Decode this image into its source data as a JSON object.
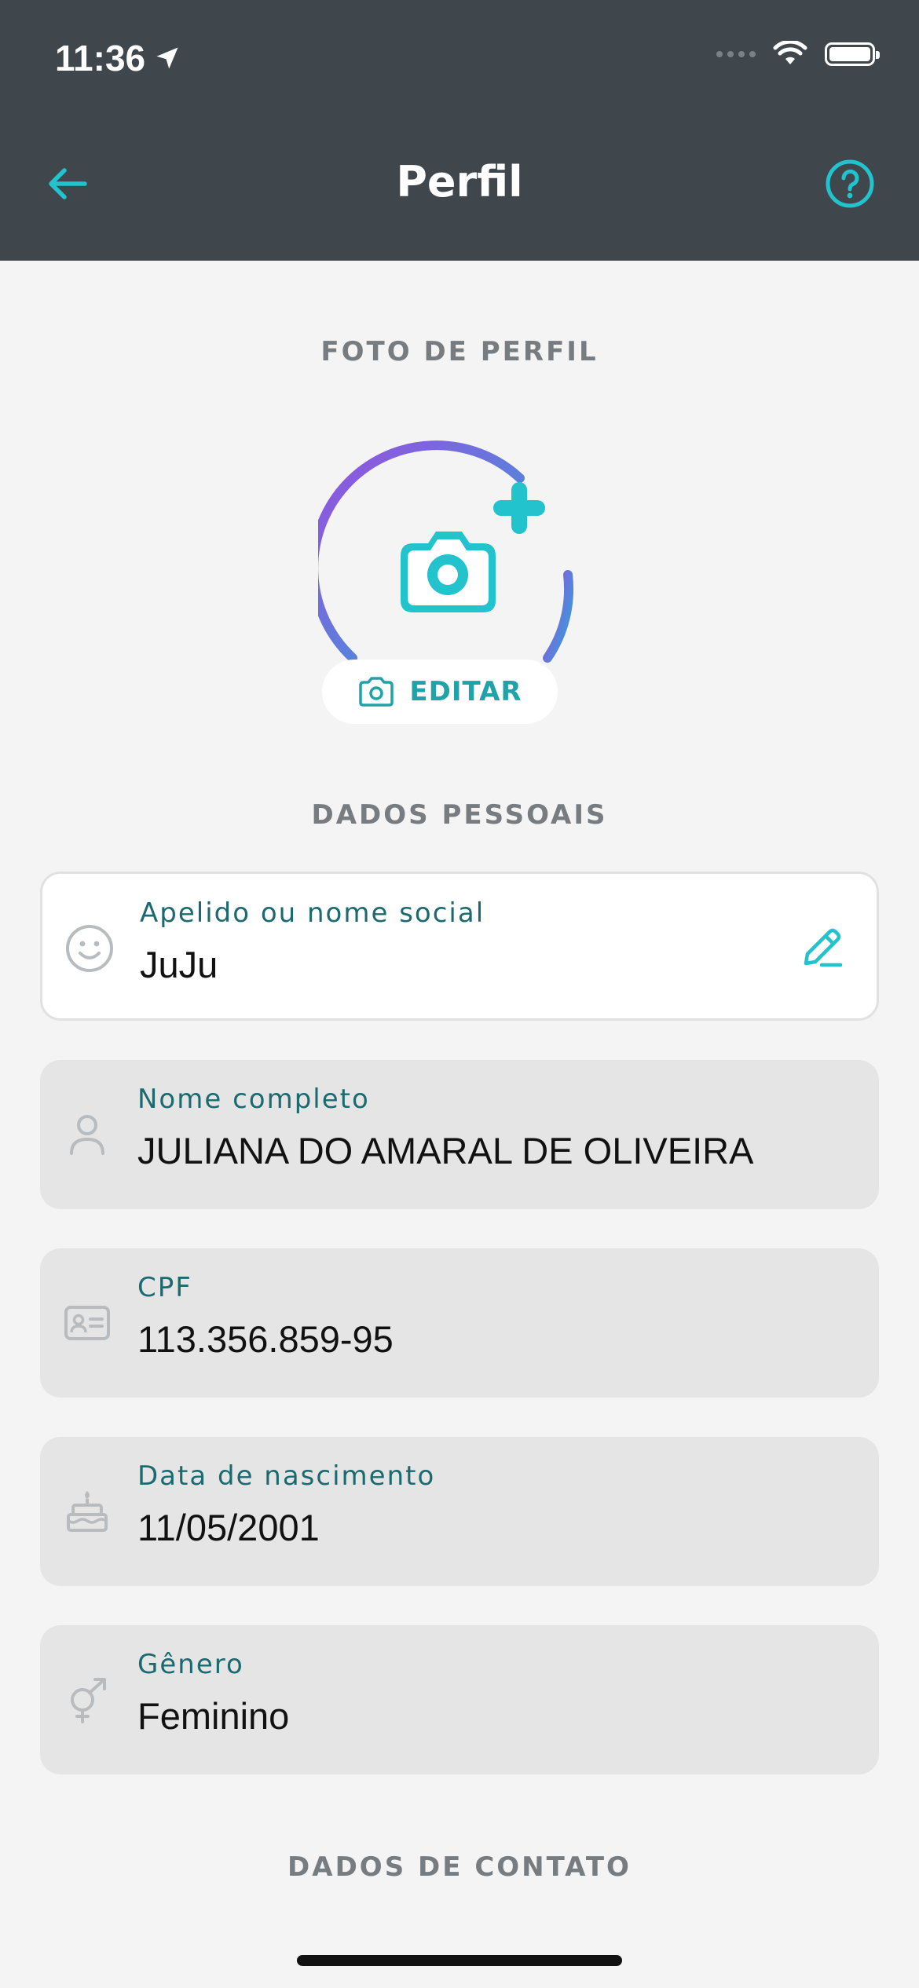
{
  "status_bar": {
    "time": "11:36"
  },
  "header": {
    "title": "Perfil"
  },
  "profile_photo": {
    "section_title": "FOTO DE PERFIL",
    "edit_label": "EDITAR"
  },
  "personal_data": {
    "section_title": "DADOS PESSOAIS",
    "fields": [
      {
        "label": "Apelido ou nome social",
        "value": "JuJu",
        "icon": "smile-icon"
      },
      {
        "label": "Nome completo",
        "value": "JULIANA DO AMARAL DE OLIVEIRA",
        "icon": "person-icon"
      },
      {
        "label": "CPF",
        "value": "113.356.859-95",
        "icon": "id-card-icon"
      },
      {
        "label": "Data de nascimento",
        "value": "11/05/2001",
        "icon": "cake-icon"
      },
      {
        "label": "Gênero",
        "value": "Feminino",
        "icon": "gender-icon"
      }
    ]
  },
  "contact_data": {
    "section_title": "DADOS DE CONTATO"
  },
  "colors": {
    "accent": "#22c3cc",
    "header_bg": "#3f464c",
    "gradient_start": "#9b4de0",
    "gradient_end": "#2fa3d8"
  }
}
